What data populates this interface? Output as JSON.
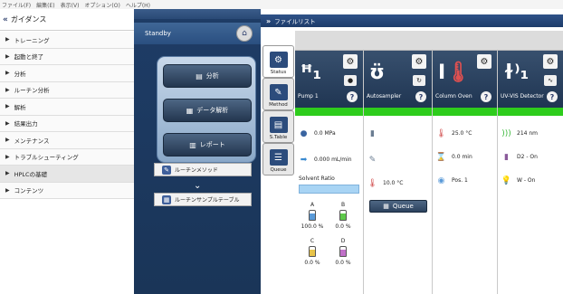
{
  "menubar": [
    "ファイル(F)",
    "編集(E)",
    "表示(V)",
    "オプション(O)",
    "ヘルプ(H)"
  ],
  "guidance": {
    "title": "ガイダンス",
    "items": [
      "トレーニング",
      "起動と終了",
      "分析",
      "ルーチン分析",
      "解析",
      "結果出力",
      "メンテナンス",
      "トラブルシューティング",
      "HPLCの基礎",
      "コンテンツ"
    ],
    "selected_index": 8
  },
  "left_panel": {
    "status": "Standby",
    "buttons": [
      "分析",
      "データ解析",
      "レポート"
    ],
    "routine_method": "ルーチンメソッド",
    "routine_sample_table": "ルーチンサンプルテーブル"
  },
  "file_list": {
    "title": "ファイルリスト"
  },
  "tabs": [
    {
      "label": "Status",
      "active": true
    },
    {
      "label": "Method",
      "active": false
    },
    {
      "label": "S.Table",
      "active": false
    },
    {
      "label": "Queue",
      "active": false
    }
  ],
  "modules": {
    "pump": {
      "name": "Pump 1",
      "pressure": "0.0 MPa",
      "flow": "0.000 mL/min",
      "solvent_ratio_label": "Solvent Ratio",
      "bottles": [
        {
          "letter": "A",
          "value": "100.0 %"
        },
        {
          "letter": "B",
          "value": "0.0 %"
        },
        {
          "letter": "C",
          "value": "0.0 %"
        },
        {
          "letter": "D",
          "value": "0.0 %"
        }
      ]
    },
    "autosampler": {
      "name": "Autosampler",
      "temperature": "10.0 °C",
      "queue_label": "Queue"
    },
    "column_oven": {
      "name": "Column Oven",
      "temperature": "25.0 °C",
      "time": "0.0 min",
      "position": "Pos. 1"
    },
    "detector": {
      "name": "UV-VIS Detector",
      "wavelength": "214 nm",
      "d2": "D2 - On",
      "w": "W - On"
    }
  },
  "colors": {
    "status_green": "#2ecc1c",
    "header_navy": "#1e3c66"
  }
}
